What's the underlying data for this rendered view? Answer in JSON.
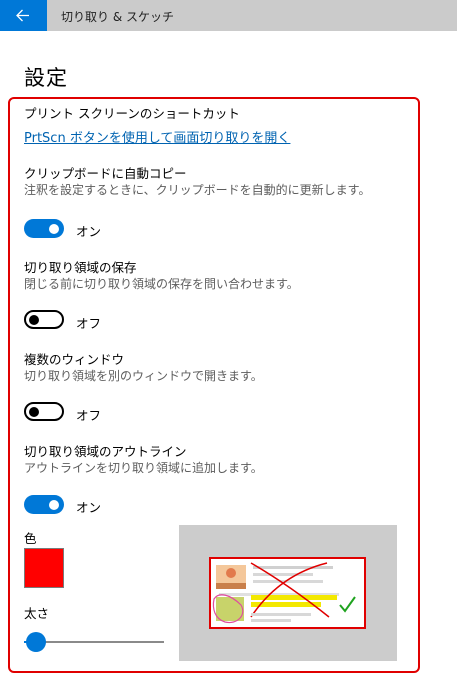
{
  "window": {
    "title": "切り取り & スケッチ"
  },
  "page": {
    "title": "設定"
  },
  "shortcut": {
    "heading": "プリント スクリーンのショートカット",
    "link": "PrtScn ボタンを使用して画面切り取りを開く"
  },
  "clipboard": {
    "heading": "クリップボードに自動コピー",
    "description": "注釈を設定するときに、クリップボードを自動的に更新します。",
    "state": "オン",
    "on": true
  },
  "save": {
    "heading": "切り取り領域の保存",
    "description": "閉じる前に切り取り領域の保存を問い合わせます。",
    "state": "オフ",
    "on": false
  },
  "multiwindow": {
    "heading": "複数のウィンドウ",
    "description": "切り取り領域を別のウィンドウで開きます。",
    "state": "オフ",
    "on": false
  },
  "outline": {
    "heading": "切り取り領域のアウトライン",
    "description": "アウトラインを切り取り領域に追加します。",
    "state": "オン",
    "on": true,
    "color_label": "色",
    "color": "#ff0000",
    "thickness_label": "太さ",
    "thickness_fraction": 0.05
  },
  "colors": {
    "accent": "#0078d7",
    "titlebar": "#cbcbcb",
    "highlight": "#e00000",
    "link": "#0063b1"
  },
  "icons": {
    "back": "arrow-left-icon"
  }
}
